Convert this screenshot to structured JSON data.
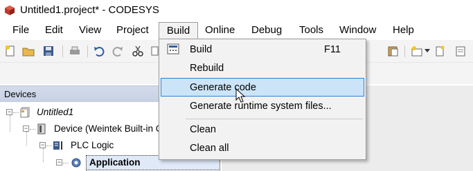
{
  "window": {
    "title": "Untitled1.project* - CODESYS"
  },
  "menubar": {
    "items": [
      "File",
      "Edit",
      "View",
      "Project",
      "Build",
      "Online",
      "Debug",
      "Tools",
      "Window",
      "Help"
    ],
    "active": "Build"
  },
  "build_menu": {
    "items": [
      {
        "label": "Build",
        "shortcut": "F11"
      },
      {
        "label": "Rebuild",
        "shortcut": ""
      },
      {
        "label": "Generate code",
        "shortcut": ""
      },
      {
        "label": "Generate runtime system files...",
        "shortcut": ""
      },
      {
        "label": "Clean",
        "shortcut": ""
      },
      {
        "label": "Clean all",
        "shortcut": ""
      }
    ],
    "highlighted": "Generate code"
  },
  "devices_panel": {
    "title": "Devices",
    "tree": [
      {
        "label": "Untitled1",
        "icon": "project-icon",
        "expander": "−"
      },
      {
        "label": "Device (Weintek Built-in C",
        "icon": "device-icon",
        "expander": "−"
      },
      {
        "label": "PLC Logic",
        "icon": "plc-logic-icon",
        "expander": "−"
      },
      {
        "label": "Application",
        "icon": "application-gear-icon",
        "expander": "−"
      }
    ]
  },
  "colors": {
    "menu_highlight": "#cce4f7",
    "menu_highlight_border": "#2f7fd0",
    "panel_header": "#c7d1e4",
    "app_icon_red": "#c0392b"
  },
  "icons": {
    "app": "codesys-cube-icon",
    "cursor": "mouse-pointer-icon"
  }
}
